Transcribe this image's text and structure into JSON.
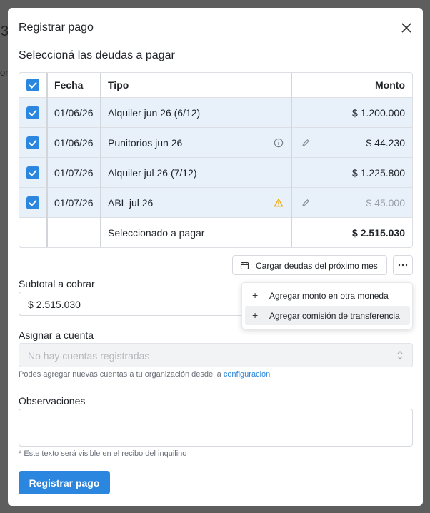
{
  "backdrop": {
    "partial_number": "3",
    "partial_text": "or"
  },
  "dialog": {
    "title": "Registrar pago",
    "section_title": "Seleccioná las deudas a pagar",
    "close_icon": "close-icon"
  },
  "table": {
    "headers": {
      "fecha": "Fecha",
      "tipo": "Tipo",
      "monto": "Monto"
    },
    "rows": [
      {
        "date": "01/06/26",
        "type": "Alquiler jun 26 (6/12)",
        "amount": "$ 1.200.000",
        "checked": true,
        "info_icon": "",
        "edit_icon": ""
      },
      {
        "date": "01/06/26",
        "type": "Punitorios jun 26",
        "amount": "$ 44.230",
        "checked": true,
        "info_icon": "info-icon",
        "edit_icon": "pencil-icon"
      },
      {
        "date": "01/07/26",
        "type": "Alquiler jul 26 (7/12)",
        "amount": "$ 1.225.800",
        "checked": true,
        "info_icon": "",
        "edit_icon": ""
      },
      {
        "date": "01/07/26",
        "type": "ABL jul 26",
        "amount": "$ 45.000",
        "checked": true,
        "info_icon": "warning-icon",
        "edit_icon": "pencil-icon"
      }
    ],
    "footer": {
      "label": "Seleccionado a pagar",
      "total": "$ 2.515.030"
    }
  },
  "actions": {
    "load_next_label": "Cargar deudas del próximo mes",
    "more_icon": "ellipsis-icon",
    "menu_items": [
      {
        "label": "Agregar monto en otra moneda"
      },
      {
        "label": "Agregar comisión de transferencia"
      }
    ]
  },
  "form": {
    "subtotal_label": "Subtotal a cobrar",
    "subtotal_value": "$ 2.515.030",
    "account_label": "Asignar a cuenta",
    "account_placeholder": "No hay cuentas registradas",
    "account_help": "Podes agregar nuevas cuentas a tu organización desde la",
    "account_help_link": "configuración",
    "notes_label": "Observaciones",
    "notes_value": "",
    "notes_help": "* Este texto será visible en el recibo del inquilino",
    "submit_label": "Registrar pago"
  },
  "colors": {
    "accent": "#2b86df",
    "selected_row": "#e8f1fa",
    "warning": "#f0a800"
  }
}
